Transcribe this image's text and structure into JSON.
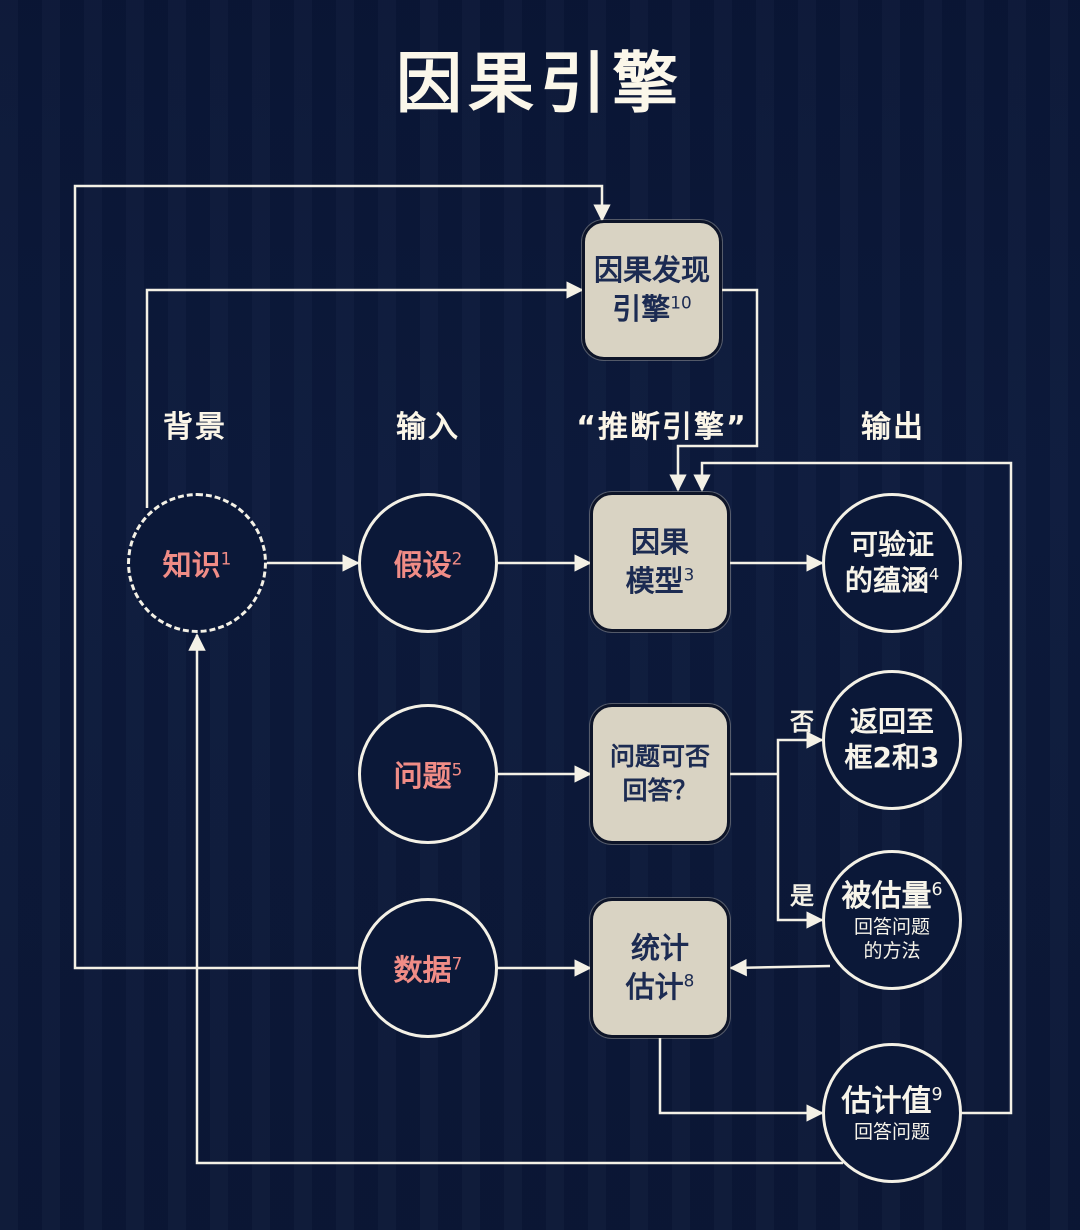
{
  "title": "因果引擎",
  "columns": {
    "background": "背景",
    "input": "输入",
    "inference": "“推断引擎”",
    "output": "输出"
  },
  "nodes": {
    "knowledge": {
      "label": "知识",
      "num": "1"
    },
    "assumptions": {
      "label": "假设",
      "num": "2"
    },
    "causal_model": {
      "line1": "因果",
      "line2": "模型",
      "num": "3"
    },
    "testable_implications": {
      "line1": "可验证",
      "line2": "的蕴涵",
      "num": "4"
    },
    "question": {
      "label": "问题",
      "num": "5"
    },
    "answerable": {
      "line1": "问题可否",
      "line2": "回答？"
    },
    "return_box": {
      "line1": "返回至",
      "line2": "框2和3"
    },
    "estimand": {
      "title": "被估量",
      "num": "6",
      "sub1": "回答问题",
      "sub2": "的方法"
    },
    "data": {
      "label": "数据",
      "num": "7"
    },
    "statistical_estimation": {
      "line1": "统计",
      "line2": "估计",
      "num": "8"
    },
    "estimate": {
      "title": "估计值",
      "num": "9",
      "sub": "回答问题"
    },
    "discovery_engine": {
      "line1": "因果发现",
      "line2": "引擎",
      "num": "10"
    }
  },
  "branches": {
    "no": "否",
    "yes": "是"
  },
  "colors": {
    "background": "#0b1838",
    "line": "#f4f1e6",
    "box_fill": "#d9d3c3",
    "box_text": "#1c2b52",
    "input_text": "#f08c86"
  }
}
